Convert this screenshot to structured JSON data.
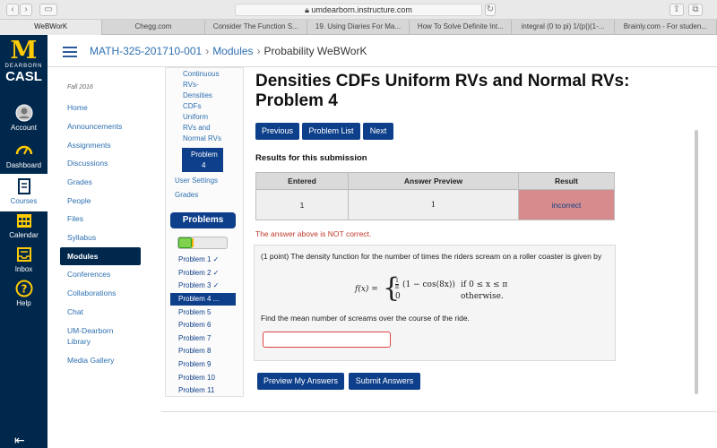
{
  "browser": {
    "url": "umdearborn.instructure.com",
    "tabs": [
      {
        "label": "WeBWorK",
        "active": true
      },
      {
        "label": "Chegg.com",
        "active": false
      },
      {
        "label": "Consider The Function S...",
        "active": false
      },
      {
        "label": "19. Using Diaries For Ma...",
        "active": false
      },
      {
        "label": "How To Solve Definite Int...",
        "active": false
      },
      {
        "label": "integral (0 to pi) 1/(p|)(1-...",
        "active": false
      },
      {
        "label": "Brainly.com - For studen...",
        "active": false
      }
    ]
  },
  "global_nav": {
    "logo_letter": "M",
    "logo_sub": "DEARBORN",
    "logo_name": "CASL",
    "items": [
      {
        "label": "Account",
        "icon": "account-icon"
      },
      {
        "label": "Dashboard",
        "icon": "dashboard-icon"
      },
      {
        "label": "Courses",
        "icon": "courses-icon",
        "active": true
      },
      {
        "label": "Calendar",
        "icon": "calendar-icon"
      },
      {
        "label": "Inbox",
        "icon": "inbox-icon"
      },
      {
        "label": "Help",
        "icon": "help-icon"
      }
    ]
  },
  "breadcrumb": {
    "course": "MATH-325-201710-001",
    "section": "Modules",
    "current": "Probability WeBWorK"
  },
  "course_nav": {
    "term": "Fall 2016",
    "items": [
      "Home",
      "Announcements",
      "Assignments",
      "Discussions",
      "Grades",
      "People",
      "Files",
      "Syllabus",
      "Modules",
      "Conferences",
      "Collaborations",
      "Chat",
      "UM-Dearborn Library",
      "Media Gallery"
    ],
    "active": "Modules"
  },
  "webwork_panel": {
    "set_link_lines": [
      "Continuous",
      "RVs-",
      "Densities",
      "CDFs",
      "Uniform",
      "RVs and",
      "Normal RVs"
    ],
    "active_problem_lines": [
      "Problem",
      "4"
    ],
    "user_settings": "User Settings",
    "grades": "Grades",
    "problems_header": "Problems",
    "progress": {
      "correct": 3,
      "total": 11
    },
    "problem_list": [
      "Problem 1 ✓",
      "Problem 2 ✓",
      "Problem 3 ✓",
      "Problem 4 ...",
      "Problem 5",
      "Problem 6",
      "Problem 7",
      "Problem 8",
      "Problem 9",
      "Problem 10",
      "Problem 11"
    ]
  },
  "main": {
    "title": "Densities CDFs Uniform RVs and Normal RVs: Problem 4",
    "buttons": {
      "previous": "Previous",
      "problem_list": "Problem List",
      "next": "Next"
    },
    "results_heading": "Results for this submission",
    "results_table": {
      "headers": [
        "Entered",
        "Answer Preview",
        "Result"
      ],
      "row": [
        "1",
        "1",
        "incorrect"
      ]
    },
    "status_message": "The answer above is NOT correct.",
    "problem_text": "(1 point) The density function for the number of times the riders scream on a roller coaster is given by",
    "formula": {
      "lhs": "f(x) =",
      "case1_expr": "(1 − cos(8x))",
      "case1_frac_num": "1",
      "case1_frac_den": "π",
      "case1_cond": "if  0 ≤ x ≤ π",
      "case2_expr": "0",
      "case2_cond": "otherwise."
    },
    "question": "Find the mean number of screams over the course of the ride.",
    "answer_value": "",
    "actions": {
      "preview": "Preview My Answers",
      "submit": "Submit Answers"
    }
  },
  "colors": {
    "nav_bg": "#00274c",
    "brand_gold": "#ffcb05",
    "button_blue": "#0e3f8a",
    "link_blue": "#2d6fb0",
    "incorrect_bg": "#d68c8c",
    "error_red": "#c0392b"
  }
}
